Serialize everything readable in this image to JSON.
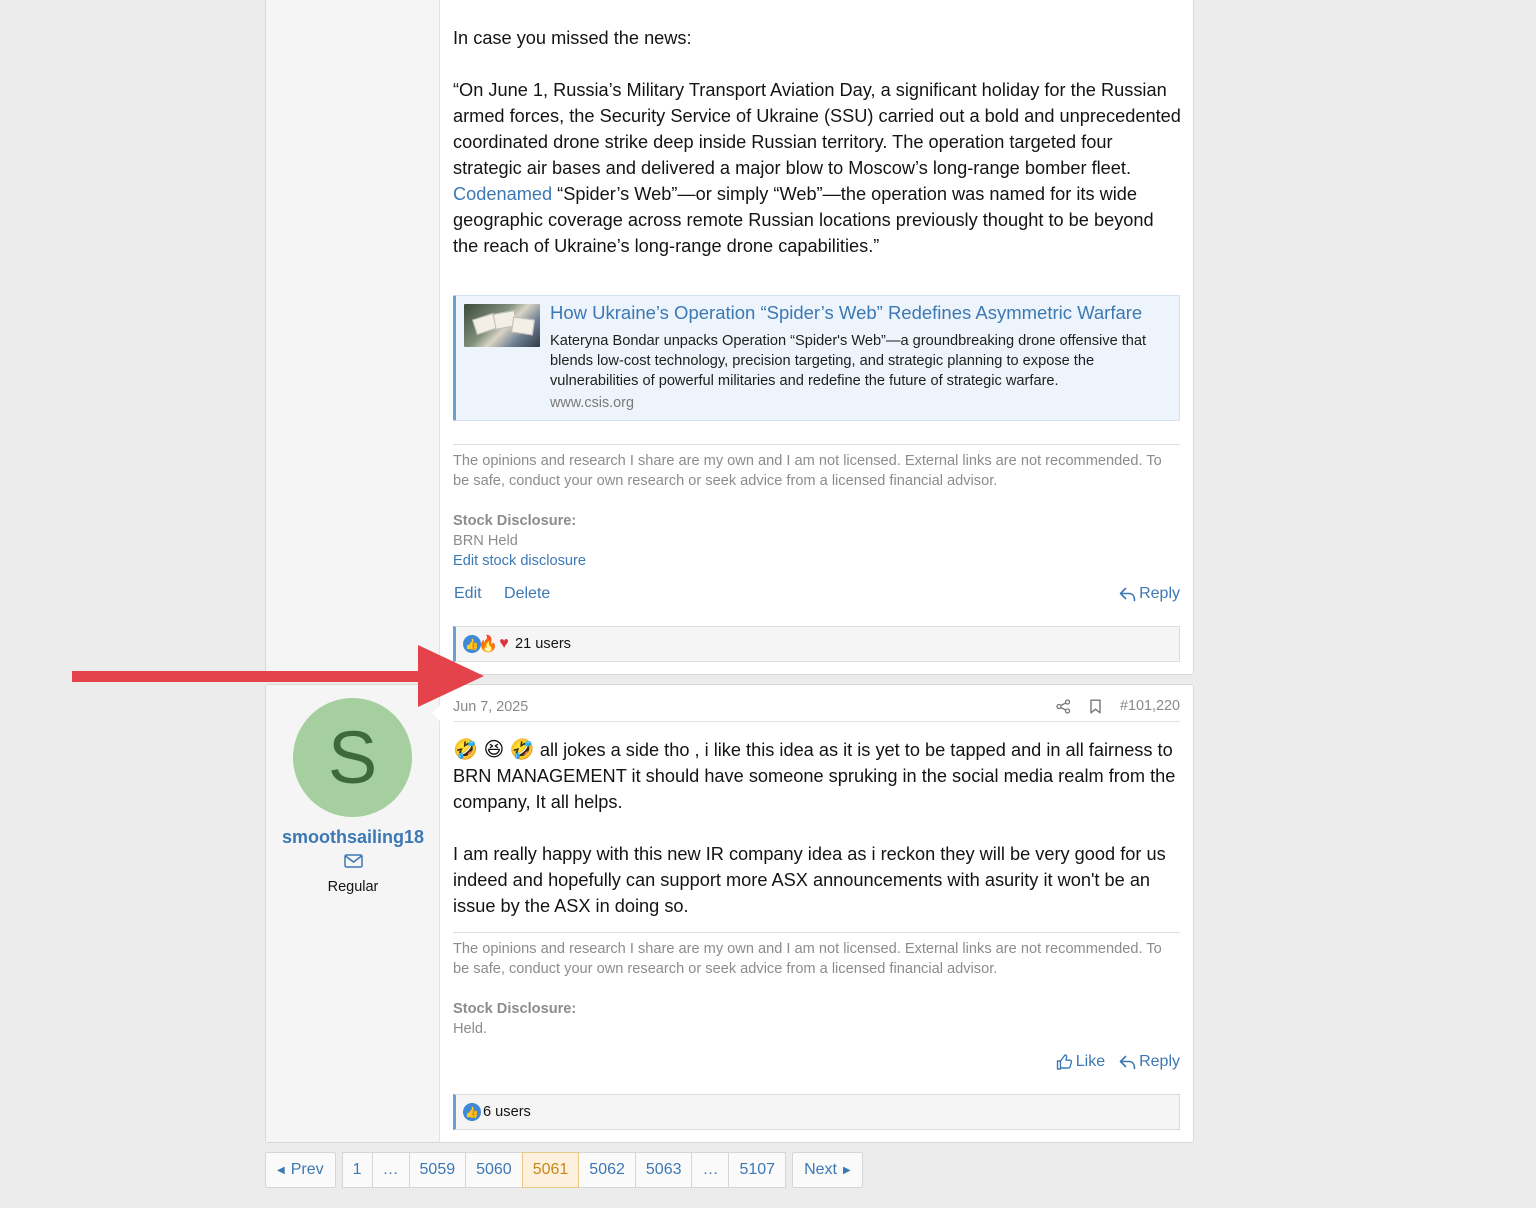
{
  "post1": {
    "intro": "In case you missed the news:",
    "quote_before_link": "“On June 1, Russia’s Military Transport Aviation Day, a significant holiday for the Russian armed forces, the Security Service of Ukraine (SSU) carried out a bold and unprecedented coordinated drone strike deep inside Russian territory. The operation targeted four strategic air bases and delivered a major blow to Moscow’s long-range bomber fleet. ",
    "quote_link": "Codenamed",
    "quote_after_link": " “Spider’s Web”—or simply “Web”—the operation was named for its wide geographic coverage across remote Russian locations previously thought to be beyond the reach of Ukraine’s long-range drone capabilities.”",
    "unfurl": {
      "title": "How Ukraine’s Operation “Spider’s Web” Redefines Asymmetric Warfare",
      "description": "Kateryna Bondar unpacks Operation “Spider's Web”—a groundbreaking drone offensive that blends low-cost technology, precision targeting, and strategic planning to expose the vulnerabilities of powerful militaries and redefine the future of strategic warfare.",
      "domain": "www.csis.org"
    },
    "signature": "The opinions and research I share are my own and I am not licensed. External links are not recommended. To be safe, conduct your own research or seek advice from a licensed financial advisor.",
    "disclosure_label": "Stock Disclosure:",
    "disclosure_value": "BRN Held",
    "edit_disclosure": "Edit stock disclosure",
    "actions": {
      "edit": "Edit",
      "delete": "Delete",
      "reply": "Reply"
    },
    "reactions": "21 users"
  },
  "post2": {
    "date": "Jun 7, 2025",
    "post_number": "#101,220",
    "user": {
      "initial": "S",
      "name": "smoothsailing18",
      "title": "Regular"
    },
    "emojis": "🤣 😆 🤣",
    "para1": " all jokes a side tho , i like this idea as it is yet to be tapped and in all fairness to BRN MANAGEMENT it should have someone spruking in the social media realm from the company, It all helps.",
    "para2": "I am really happy with this new IR company idea as i reckon they will be very good for us indeed and hopefully can support more ASX announcements with asurity it won't be an issue by the ASX in doing so.",
    "signature": "The opinions and research I share are my own and I am not licensed. External links are not recommended. To be safe, conduct your own research or seek advice from a licensed financial advisor.",
    "disclosure_label": "Stock Disclosure:",
    "disclosure_value": "Held.",
    "actions": {
      "like": "Like",
      "reply": "Reply"
    },
    "reactions": "6 users"
  },
  "pagination": {
    "prev": "Prev",
    "next": "Next",
    "pages": [
      "1",
      "…",
      "5059",
      "5060",
      "5061",
      "5062",
      "5063",
      "…",
      "5107"
    ],
    "current": "5061"
  },
  "colors": {
    "link": "#3c78b4",
    "annotation_arrow": "#e5434b",
    "avatar_bg": "#a6cf9f"
  }
}
